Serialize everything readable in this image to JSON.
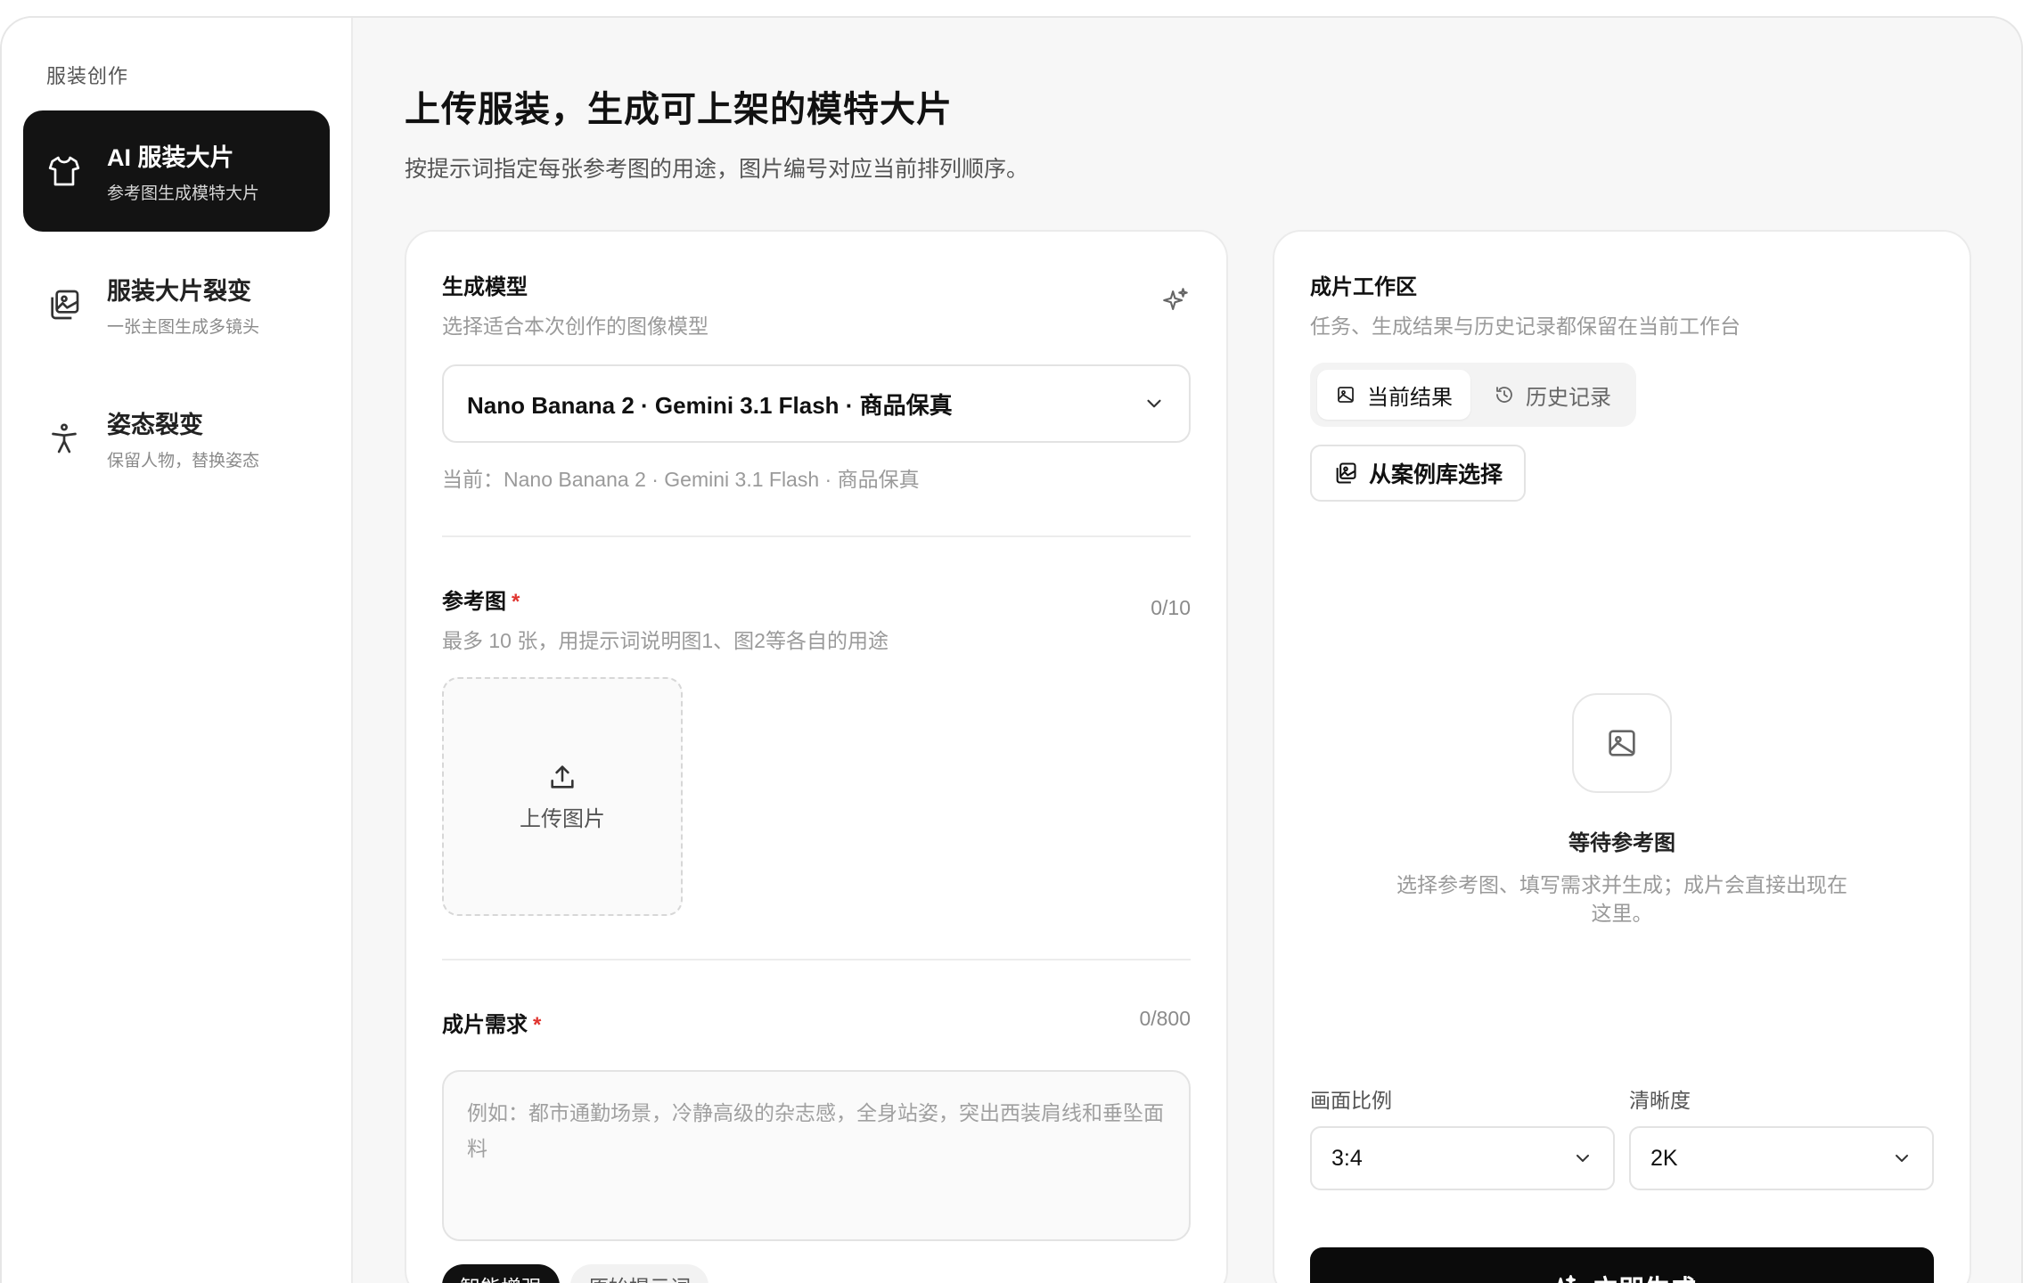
{
  "sidebar": {
    "heading": "服装创作",
    "items": [
      {
        "title": "AI 服装大片",
        "sub": "参考图生成模特大片",
        "icon": "tshirt-icon"
      },
      {
        "title": "服装大片裂变",
        "sub": "一张主图生成多镜头",
        "icon": "images-icon"
      },
      {
        "title": "姿态裂变",
        "sub": "保留人物，替换姿态",
        "icon": "person-pose-icon"
      }
    ]
  },
  "header": {
    "title": "上传服装，生成可上架的模特大片",
    "subtitle": "按提示词指定每张参考图的用途，图片编号对应当前排列顺序。"
  },
  "model": {
    "title": "生成模型",
    "desc": "选择适合本次创作的图像模型",
    "selected": "Nano Banana 2 · Gemini 3.1 Flash · 商品保真",
    "current": "当前：Nano Banana 2 · Gemini 3.1 Flash · 商品保真"
  },
  "reference": {
    "title": "参考图",
    "required": "*",
    "desc": "最多 10 张，用提示词说明图1、图2等各自的用途",
    "counter": "0/10",
    "upload_label": "上传图片"
  },
  "requirement": {
    "title": "成片需求",
    "required": "*",
    "counter": "0/800",
    "placeholder": "例如：都市通勤场景，冷静高级的杂志感，全身站姿，突出西装肩线和垂坠面料",
    "chips": [
      "智能增强",
      "原始提示词"
    ]
  },
  "workspace": {
    "title": "成片工作区",
    "desc": "任务、生成结果与历史记录都保留在当前工作台",
    "tabs": [
      "当前结果",
      "历史记录"
    ],
    "library_button": "从案例库选择",
    "empty_title": "等待参考图",
    "empty_desc": "选择参考图、填写需求并生成；成片会直接出现在这里。",
    "ratio_label": "画面比例",
    "ratio_value": "3:4",
    "quality_label": "清晰度",
    "quality_value": "2K",
    "generate_button": "立即生成"
  }
}
